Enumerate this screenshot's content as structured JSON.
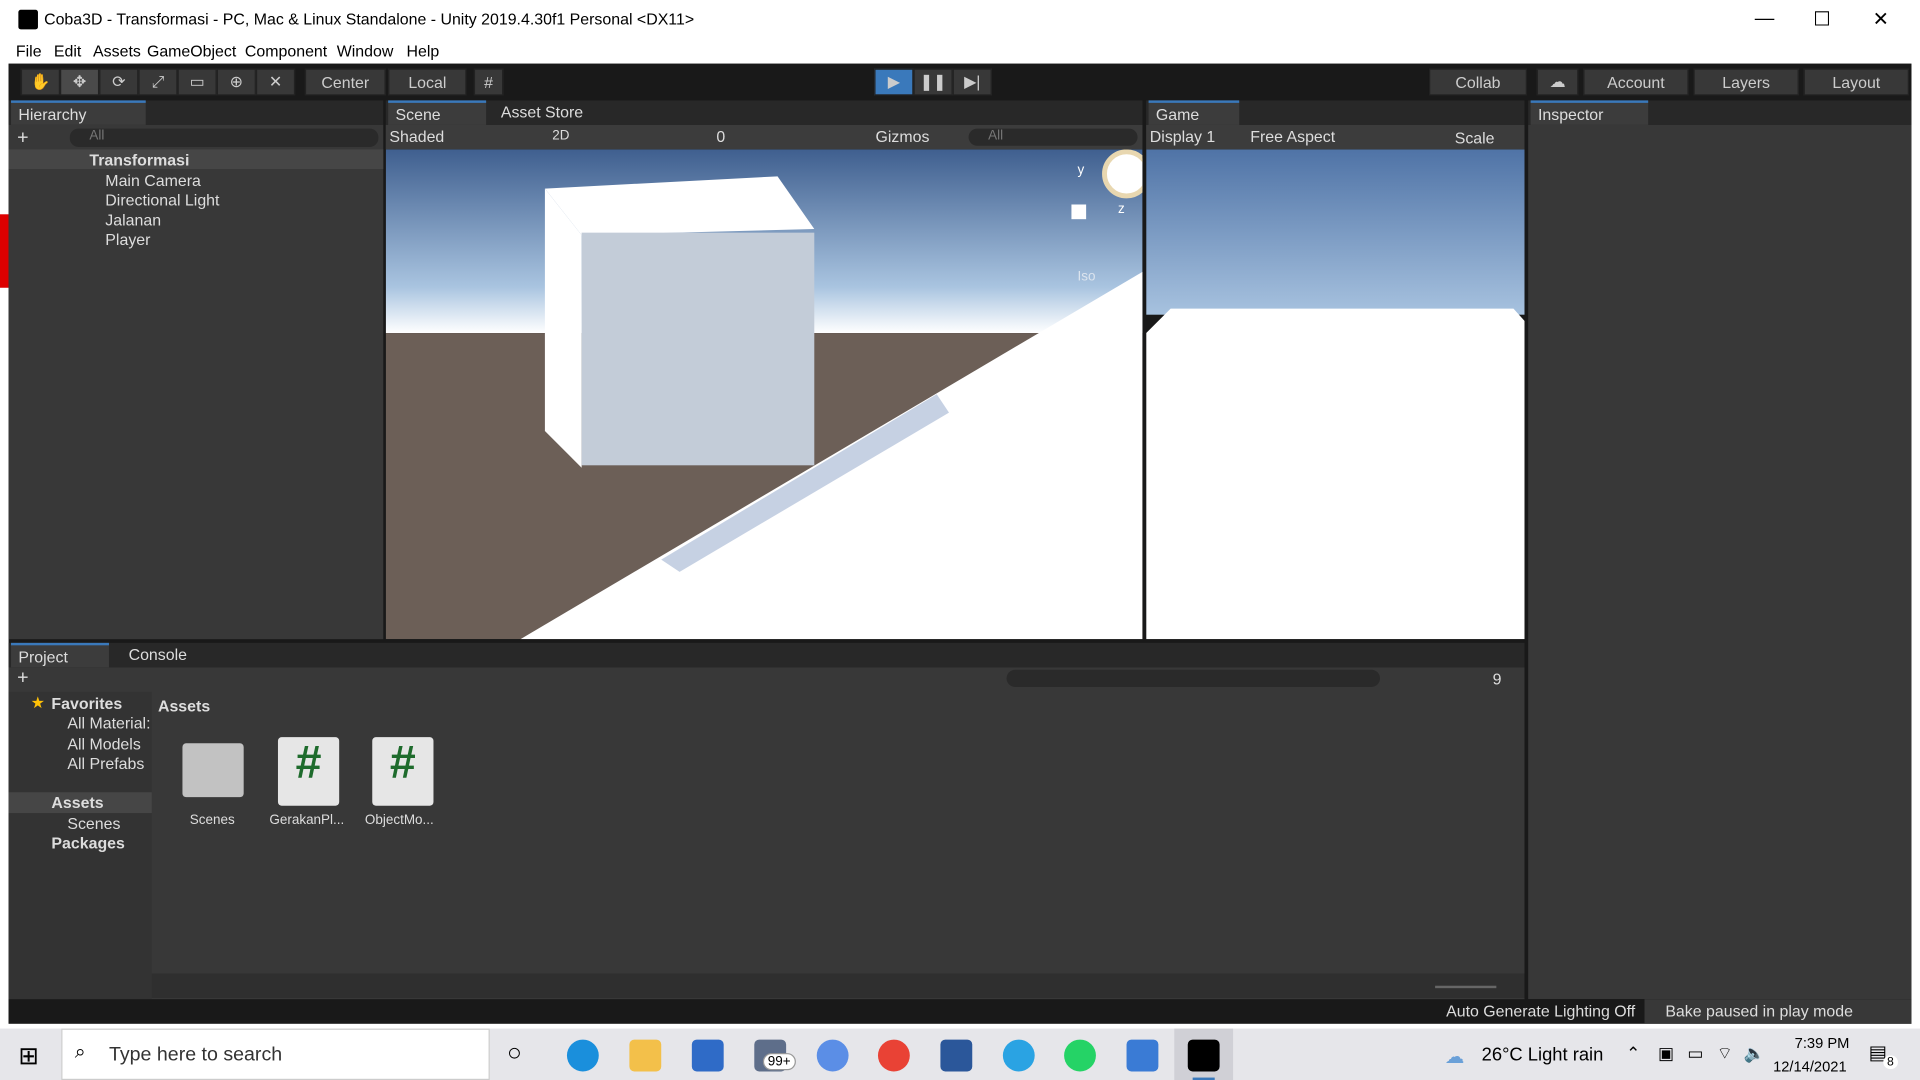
{
  "window": {
    "title": "Coba3D - Transformasi - PC, Mac & Linux Standalone - Unity 2019.4.30f1 Personal <DX11>",
    "min": "—",
    "max": "☐",
    "close": "✕"
  },
  "menu": [
    "File",
    "Edit",
    "Assets",
    "GameObject",
    "Component",
    "Window",
    "Help"
  ],
  "toolbar": {
    "center": "Center",
    "local": "Local",
    "collab": "Collab",
    "account": "Account",
    "layers": "Layers",
    "layout": "Layout"
  },
  "hierarchy": {
    "tab": "Hierarchy",
    "search_placeholder": "All",
    "scene": "Transformasi",
    "items": [
      "Main Camera",
      "Directional Light",
      "Jalanan",
      "Player"
    ]
  },
  "scene": {
    "tab": "Scene",
    "store_tab": "Asset Store",
    "mode": "Shaded",
    "btn2d": "2D",
    "hidden_count": "0",
    "gizmos": "Gizmos",
    "search_placeholder": "All",
    "iso": "Iso",
    "axis_y": "y",
    "axis_z": "z"
  },
  "game": {
    "tab": "Game",
    "display": "Display 1",
    "aspect": "Free Aspect",
    "scale": "Scale"
  },
  "inspector": {
    "tab": "Inspector"
  },
  "project": {
    "tab": "Project",
    "console_tab": "Console",
    "badge": "9",
    "favorites": "Favorites",
    "fav_items": [
      "All Material:",
      "All Models",
      "All Prefabs"
    ],
    "assets_folder": "Assets",
    "scenes": "Scenes",
    "packages": "Packages",
    "breadcrumb": "Assets",
    "items": [
      "Scenes",
      "GerakanPl...",
      "ObjectMo..."
    ]
  },
  "status": {
    "lighting": "Auto Generate Lighting Off",
    "bake": "Bake paused in play mode"
  },
  "taskbar": {
    "search_placeholder": "Type here to search",
    "mail_badge": "99+",
    "weather": "26°C  Light rain",
    "time": "7:39 PM",
    "date": "12/14/2021",
    "notif": "8"
  }
}
